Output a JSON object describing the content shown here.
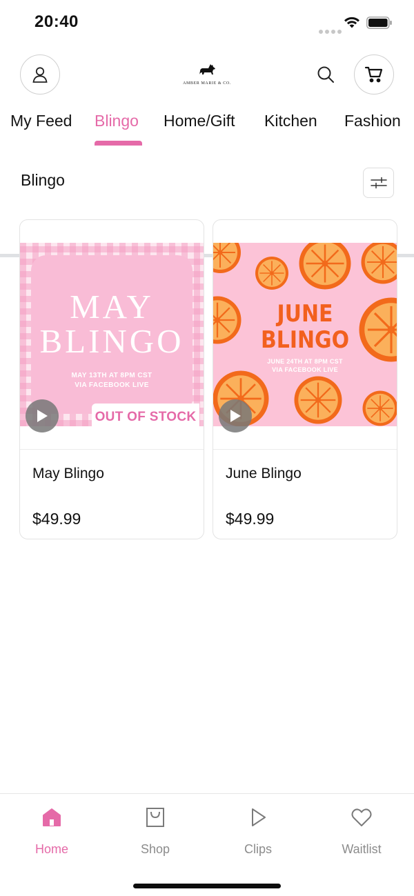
{
  "status_bar": {
    "time": "20:40"
  },
  "header": {
    "logo_text": "AMBER MARIE & CO."
  },
  "tabs": [
    {
      "label": "My Feed",
      "active": false
    },
    {
      "label": "Blingo",
      "active": true
    },
    {
      "label": "Home/Gift",
      "active": false
    },
    {
      "label": "Kitchen",
      "active": false
    },
    {
      "label": "Fashion",
      "active": false
    }
  ],
  "section": {
    "title": "Blingo"
  },
  "products": [
    {
      "name": "May Blingo",
      "price": "$49.99",
      "badge": "OUT OF STOCK",
      "image_headline_1": "MAY",
      "image_headline_2": "BLINGO",
      "image_sub_1": "MAY 13TH AT 8PM CST",
      "image_sub_2": "VIA FACEBOOK LIVE"
    },
    {
      "name": "June Blingo",
      "price": "$49.99",
      "image_headline_1": "JUNE",
      "image_headline_2": "BLINGO",
      "image_sub_1": "JUNE 24TH AT 8PM CST",
      "image_sub_2": "VIA FACEBOOK LIVE"
    }
  ],
  "bottom_nav": [
    {
      "label": "Home",
      "icon": "home-icon",
      "active": true
    },
    {
      "label": "Shop",
      "icon": "shopping-bag-icon",
      "active": false
    },
    {
      "label": "Clips",
      "icon": "play-icon",
      "active": false
    },
    {
      "label": "Waitlist",
      "icon": "heart-icon",
      "active": false
    }
  ],
  "colors": {
    "accent": "#e56aa8",
    "muted": "#8c8c8c",
    "divider": "#dfe1e4"
  }
}
